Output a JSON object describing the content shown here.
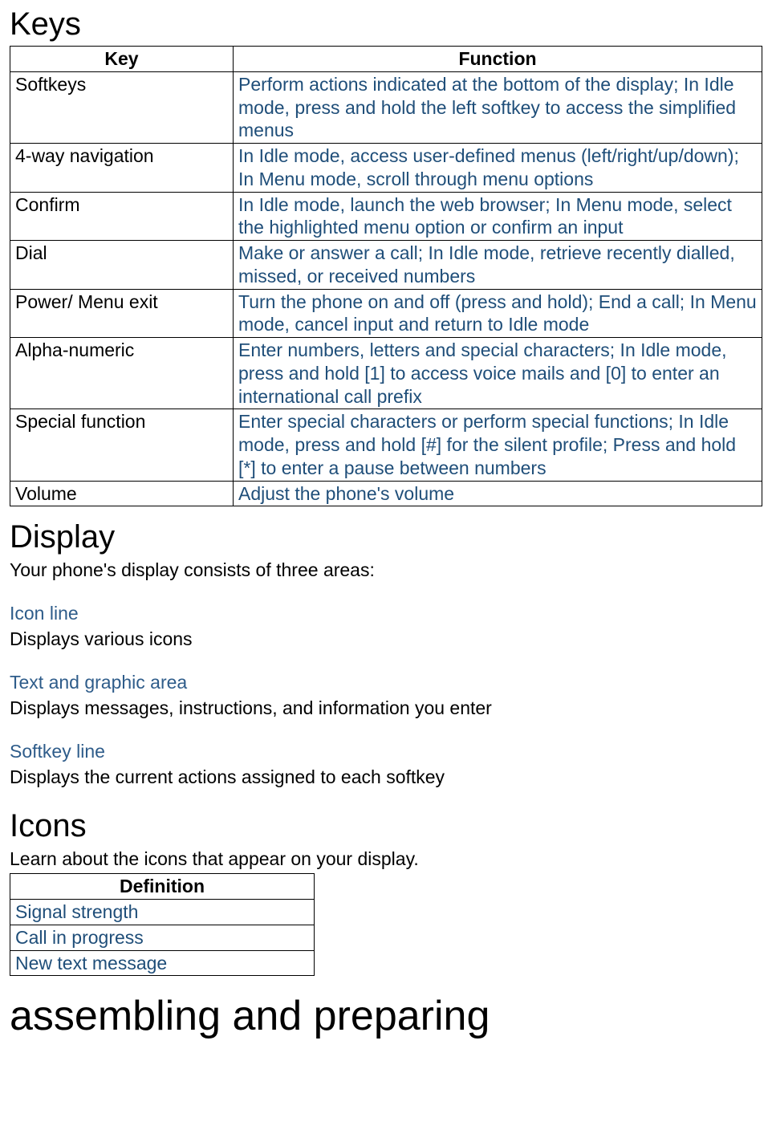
{
  "keys": {
    "heading": "Keys",
    "headers": {
      "key": "Key",
      "function": "Function"
    },
    "rows": [
      {
        "key": "Softkeys",
        "function": "Perform actions indicated at the bottom of the display; In Idle mode, press and hold the left softkey to access the simplified menus"
      },
      {
        "key": "4-way navigation",
        "function": "In Idle mode, access user-defined menus (left/right/up/down); In Menu mode, scroll through menu options"
      },
      {
        "key": "Confirm",
        "function": "In Idle mode, launch the web browser; In Menu mode, select the highlighted menu option or confirm an input"
      },
      {
        "key": "Dial",
        "function": "Make or answer a call; In Idle mode, retrieve recently dialled, missed, or received numbers"
      },
      {
        "key": "Power/ Menu exit",
        "function": "Turn the phone on and off (press and hold); End a call; In Menu mode, cancel input and return to Idle mode"
      },
      {
        "key": "Alpha-numeric",
        "function": "Enter numbers, letters and special characters; In Idle mode, press and hold [1] to access voice mails and [0] to enter an international call prefix"
      },
      {
        "key": "Special function",
        "function": "Enter special characters or perform special functions; In Idle mode, press and hold [#] for the silent profile; Press and hold [*] to enter a pause between numbers"
      },
      {
        "key": "Volume",
        "function": "Adjust the phone's volume"
      }
    ]
  },
  "display": {
    "heading": "Display",
    "intro": "Your phone's display consists of three areas:",
    "areas": [
      {
        "label": "Icon line",
        "desc": "Displays various icons"
      },
      {
        "label": "Text and graphic area",
        "desc": "Displays messages, instructions, and information you enter"
      },
      {
        "label": "Softkey line",
        "desc": "Displays the current actions assigned to each softkey"
      }
    ]
  },
  "icons": {
    "heading": "Icons",
    "intro": "Learn about the icons that appear on your display.",
    "header": "Definition",
    "rows": [
      "Signal strength",
      "Call in progress",
      "New text message"
    ]
  },
  "assembling": {
    "heading": "assembling and preparing"
  }
}
